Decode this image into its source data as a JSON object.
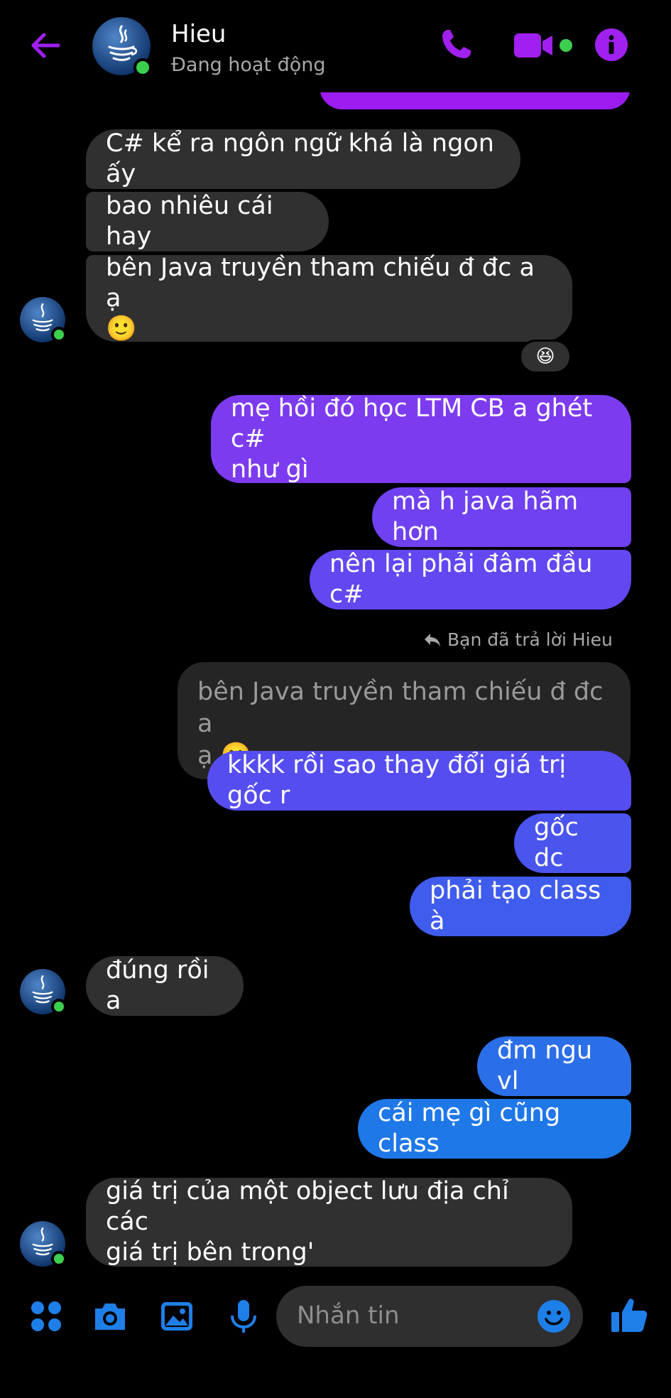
{
  "header": {
    "name": "Hieu",
    "status": "Đang hoạt động"
  },
  "messages": {
    "m1": "C# kể ra ngôn ngữ khá là ngon ấy",
    "m2": "bao nhiêu cái hay",
    "m3": "bên Java truyền tham chiếu đ đc a ạ\n🙂",
    "reaction": "😆",
    "m4": "mẹ hồi đó học LTM CB a ghét c#\nnhư gì",
    "m5": "mà h java hãm hơn",
    "m6": "nên lại phải đâm đầu c#",
    "reply_note": "Bạn đã trả lời Hieu",
    "quoted": "bên Java truyền tham chiếu đ đc a\nạ 🙂",
    "m7": "kkkk rồi sao thay đổi giá trị gốc r",
    "m8": "gốc dc",
    "m9": "phải tạo class à",
    "m10": "đúng rồi a",
    "m11": "đm ngu vl",
    "m12": "cái mẹ gì cũng class",
    "m13": "giá trị của một object lưu địa chỉ các\ngiá trị bên trong'"
  },
  "composer": {
    "placeholder": "Nhắn tin"
  },
  "colors": {
    "accent": "#9c1cf0",
    "incoming_bubble": "#303030",
    "online": "#3ccf4e",
    "composer_blue": "#1e7fe8"
  },
  "icons": [
    "back-arrow-icon",
    "phone-icon",
    "video-icon",
    "info-icon",
    "menu-grid-icon",
    "camera-icon",
    "gallery-icon",
    "microphone-icon",
    "emoji-icon",
    "thumbs-up-icon"
  ]
}
